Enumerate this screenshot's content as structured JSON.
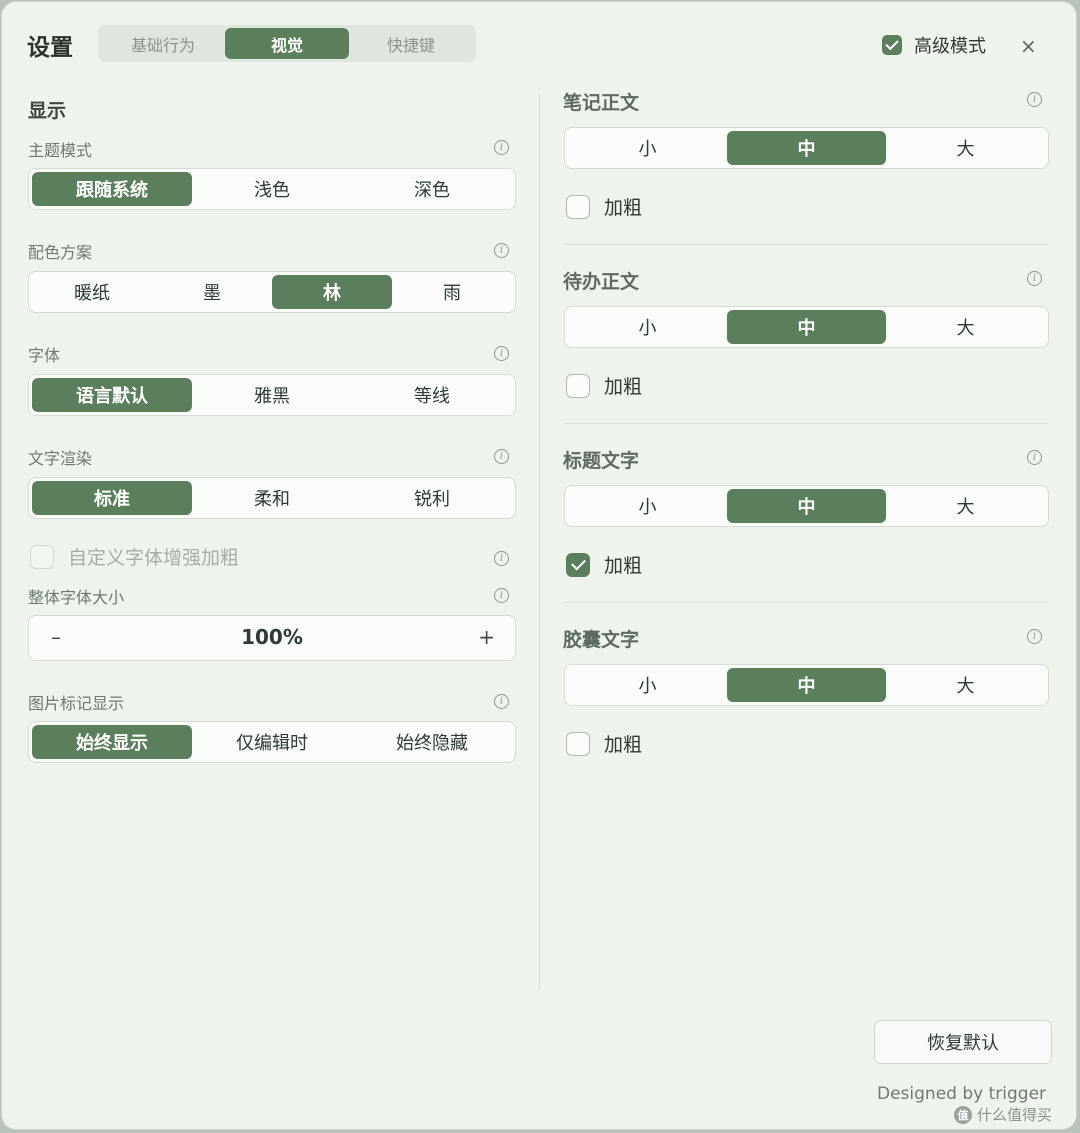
{
  "header": {
    "title": "设置",
    "tabs": [
      "基础行为",
      "视觉",
      "快捷键"
    ],
    "active_tab": 1,
    "advanced_label": "高级模式",
    "advanced_checked": true,
    "close_glyph": "×"
  },
  "left": {
    "section_title": "显示",
    "theme": {
      "label": "主题模式",
      "options": [
        "跟随系统",
        "浅色",
        "深色"
      ],
      "selected": 0
    },
    "color_scheme": {
      "label": "配色方案",
      "options": [
        "暖纸",
        "墨",
        "林",
        "雨"
      ],
      "selected": 2
    },
    "font": {
      "label": "字体",
      "options": [
        "语言默认",
        "雅黑",
        "等线"
      ],
      "selected": 0
    },
    "rendering": {
      "label": "文字渲染",
      "options": [
        "标准",
        "柔和",
        "锐利"
      ],
      "selected": 0
    },
    "custom_bold": {
      "label": "自定义字体增强加粗",
      "checked": false,
      "disabled": true
    },
    "font_size": {
      "label": "整体字体大小",
      "value": "100%",
      "minus": "–",
      "plus": "+"
    },
    "image_marker": {
      "label": "图片标记显示",
      "options": [
        "始终显示",
        "仅编辑时",
        "始终隐藏"
      ],
      "selected": 0
    }
  },
  "right": {
    "note_body": {
      "title": "笔记正文",
      "options": [
        "小",
        "中",
        "大"
      ],
      "selected": 1,
      "bold_label": "加粗",
      "bold_checked": false
    },
    "todo_body": {
      "title": "待办正文",
      "options": [
        "小",
        "中",
        "大"
      ],
      "selected": 1,
      "bold_label": "加粗",
      "bold_checked": false
    },
    "heading_text": {
      "title": "标题文字",
      "options": [
        "小",
        "中",
        "大"
      ],
      "selected": 1,
      "bold_label": "加粗",
      "bold_checked": true
    },
    "capsule_text": {
      "title": "胶囊文字",
      "options": [
        "小",
        "中",
        "大"
      ],
      "selected": 1,
      "bold_label": "加粗",
      "bold_checked": false
    }
  },
  "footer": {
    "reset_label": "恢复默认",
    "credit": "Designed by trigger",
    "watermark": "什么值得买",
    "watermark_badge": "值"
  },
  "icons": {
    "info": "i"
  },
  "colors": {
    "accent": "#5b7f5d",
    "background": "#eef4ec"
  }
}
